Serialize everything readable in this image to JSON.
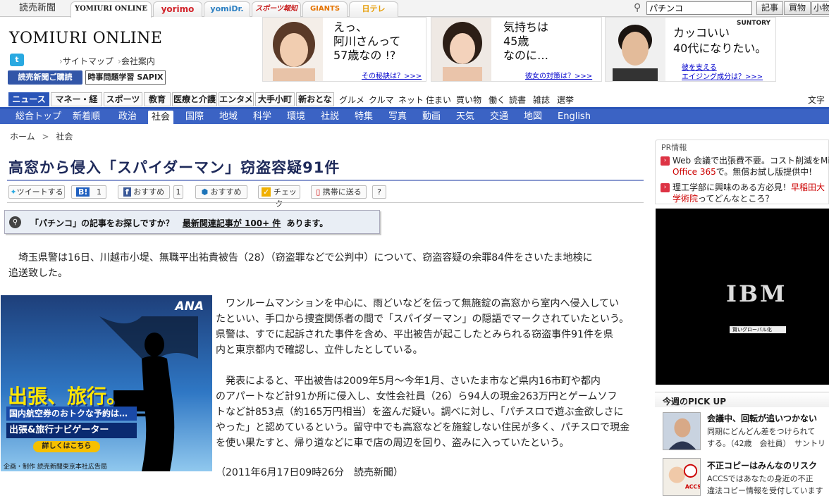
{
  "topbar": {
    "tabs": [
      "読売新聞",
      "YOMIURI ONLINE",
      "yorimo",
      "yomiDr.",
      "スポーツ報知",
      "GIANTS",
      "日テレ"
    ],
    "search_value": "パチンコ",
    "search_buttons": [
      "記事",
      "買物",
      "小物"
    ]
  },
  "header": {
    "logo": "YOMIURI ONLINE",
    "twitter_icon": "t",
    "links": [
      "サイトマップ",
      "会社案内"
    ],
    "subscribe_button": "読売新聞ご購読",
    "sapix_button": "時事問題学習 SAPIX"
  },
  "ads": [
    {
      "lines": [
        "えっ、",
        "阿川さんって",
        "57歳なの !?"
      ],
      "link": "その秘訣は？>>>"
    },
    {
      "lines": [
        "気持ちは",
        "45歳",
        "なのに…"
      ],
      "link": "彼女の対策は？>>>"
    },
    {
      "brand": "SUNTORY",
      "lines": [
        "カッコいい",
        "40代になりたい。"
      ],
      "link1": "彼を支える",
      "link2": "エイジング成分は？>>>"
    }
  ],
  "nav_primary": {
    "items": [
      "ニュース",
      "マネー・経済",
      "スポーツ",
      "教育",
      "医療と介護",
      "エンタメ",
      "大手小町",
      "新おとな"
    ],
    "text_items": [
      "グルメ",
      "クルマ",
      "ネット",
      "住まい",
      "買い物",
      "働く",
      "読書",
      "雑誌",
      "選挙"
    ],
    "right_label": "文字"
  },
  "nav_secondary": {
    "items": [
      "総合トップ",
      "新着順",
      "政治",
      "社会",
      "国際",
      "地域",
      "科学",
      "環境",
      "社説",
      "特集",
      "写真",
      "動画",
      "天気",
      "交通",
      "地図",
      "English"
    ]
  },
  "breadcrumb": {
    "home": "ホーム",
    "sep": ">",
    "current": "社会"
  },
  "article": {
    "title": "高窓から侵入「スパイダーマン」窃盗容疑91件",
    "social": {
      "tweet": "ツイートする",
      "hatena_label": "B!",
      "hatena_count": "1",
      "fb_label": "おすすめ",
      "fb_count": "1",
      "mixi_label": "おすすめ",
      "check": "チェック",
      "mobile": "携帯に送る",
      "help": "?"
    },
    "related": {
      "before": "「パチンコ」の記事をお探しですか？",
      "link": "最新関連記事が 100+ 件",
      "after": "あります。"
    },
    "paragraph1": [
      "　埼玉県警は16日、川越市小堤、無職平出祐貴被告（28）（窃盗罪などで公判中）について、窃盗容疑の余罪84件をさいたま地検に",
      "追送致した。"
    ],
    "paragraph2": [
      "　ワンルームマンションを中心に、雨どいなどを伝って無施錠の高窓から室内へ侵入してい",
      "たといい、手口から捜査関係者の間で「スパイダーマン」の隠語でマークされていたという。",
      "県警は、すでに起訴された事件を含め、平出被告が起こしたとみられる窃盗事件91件を県",
      "内と東京都内で確認し、立件したとしている。"
    ],
    "paragraph3": [
      "　発表によると、平出被告は2009年5月～今年1月、さいたま市など県内16市町や都内",
      "のアパートなど計91か所に侵入し、女性会社員（26）ら94人の現金263万円とゲームソフ",
      "トなど計853点（約165万円相当）を盗んだ疑い。調べに対し、「パチスロで遊ぶ金欲しさに",
      "やった」と認めているという。留守中でも高窓などを施錠しない住民が多く、パチスロで現金",
      "を使い果たすと、帰り道などに車で店の周辺を回り、盗みに入っていたという。"
    ],
    "dateline": "（2011年6月17日09時26分　読売新聞）"
  },
  "ana_ad": {
    "logo": "ANA",
    "headline": "出張、旅行。",
    "sub": "国内航空券のおトクな予約は…",
    "navigator": "出張&旅行ナビゲーター",
    "button": "詳しくはこちら",
    "credit": "企画・制作 読売新聞東京本社広告局"
  },
  "pr": {
    "heading": "PR情報",
    "items": [
      {
        "line1": "Web 会議で出張費不要。コスト削減をMi",
        "line2": "Office 365で。無償お試し版提供中!",
        "line2_red": "Office 365"
      },
      {
        "line1": "理工学部に興味のある方必見！早稲田大",
        "line1_red": "早稲田大",
        "line2": "学術院ってどんなところ？",
        "line2_red": "学術院"
      }
    ]
  },
  "ibm_ad": {
    "logo": "IBM",
    "bar": "賢いグローバル化"
  },
  "pickup": {
    "heading": "今週のPICK UP",
    "items": [
      {
        "title": "会議中、回転が追いつかない",
        "desc1": "同期にどんどん差をつけられて",
        "desc2": "する。（42歳　会社員）　サントリ"
      },
      {
        "title": "不正コピーはみんなのリスク",
        "badge": "ACCS",
        "desc1": "ACCSではあなたの身近の不正",
        "desc2": "違法コピー情報を受付しています"
      }
    ]
  },
  "colors": {
    "nav_blue": "#2a55b8",
    "title_navy": "#1e2a5a",
    "accent_red": "#c00"
  }
}
